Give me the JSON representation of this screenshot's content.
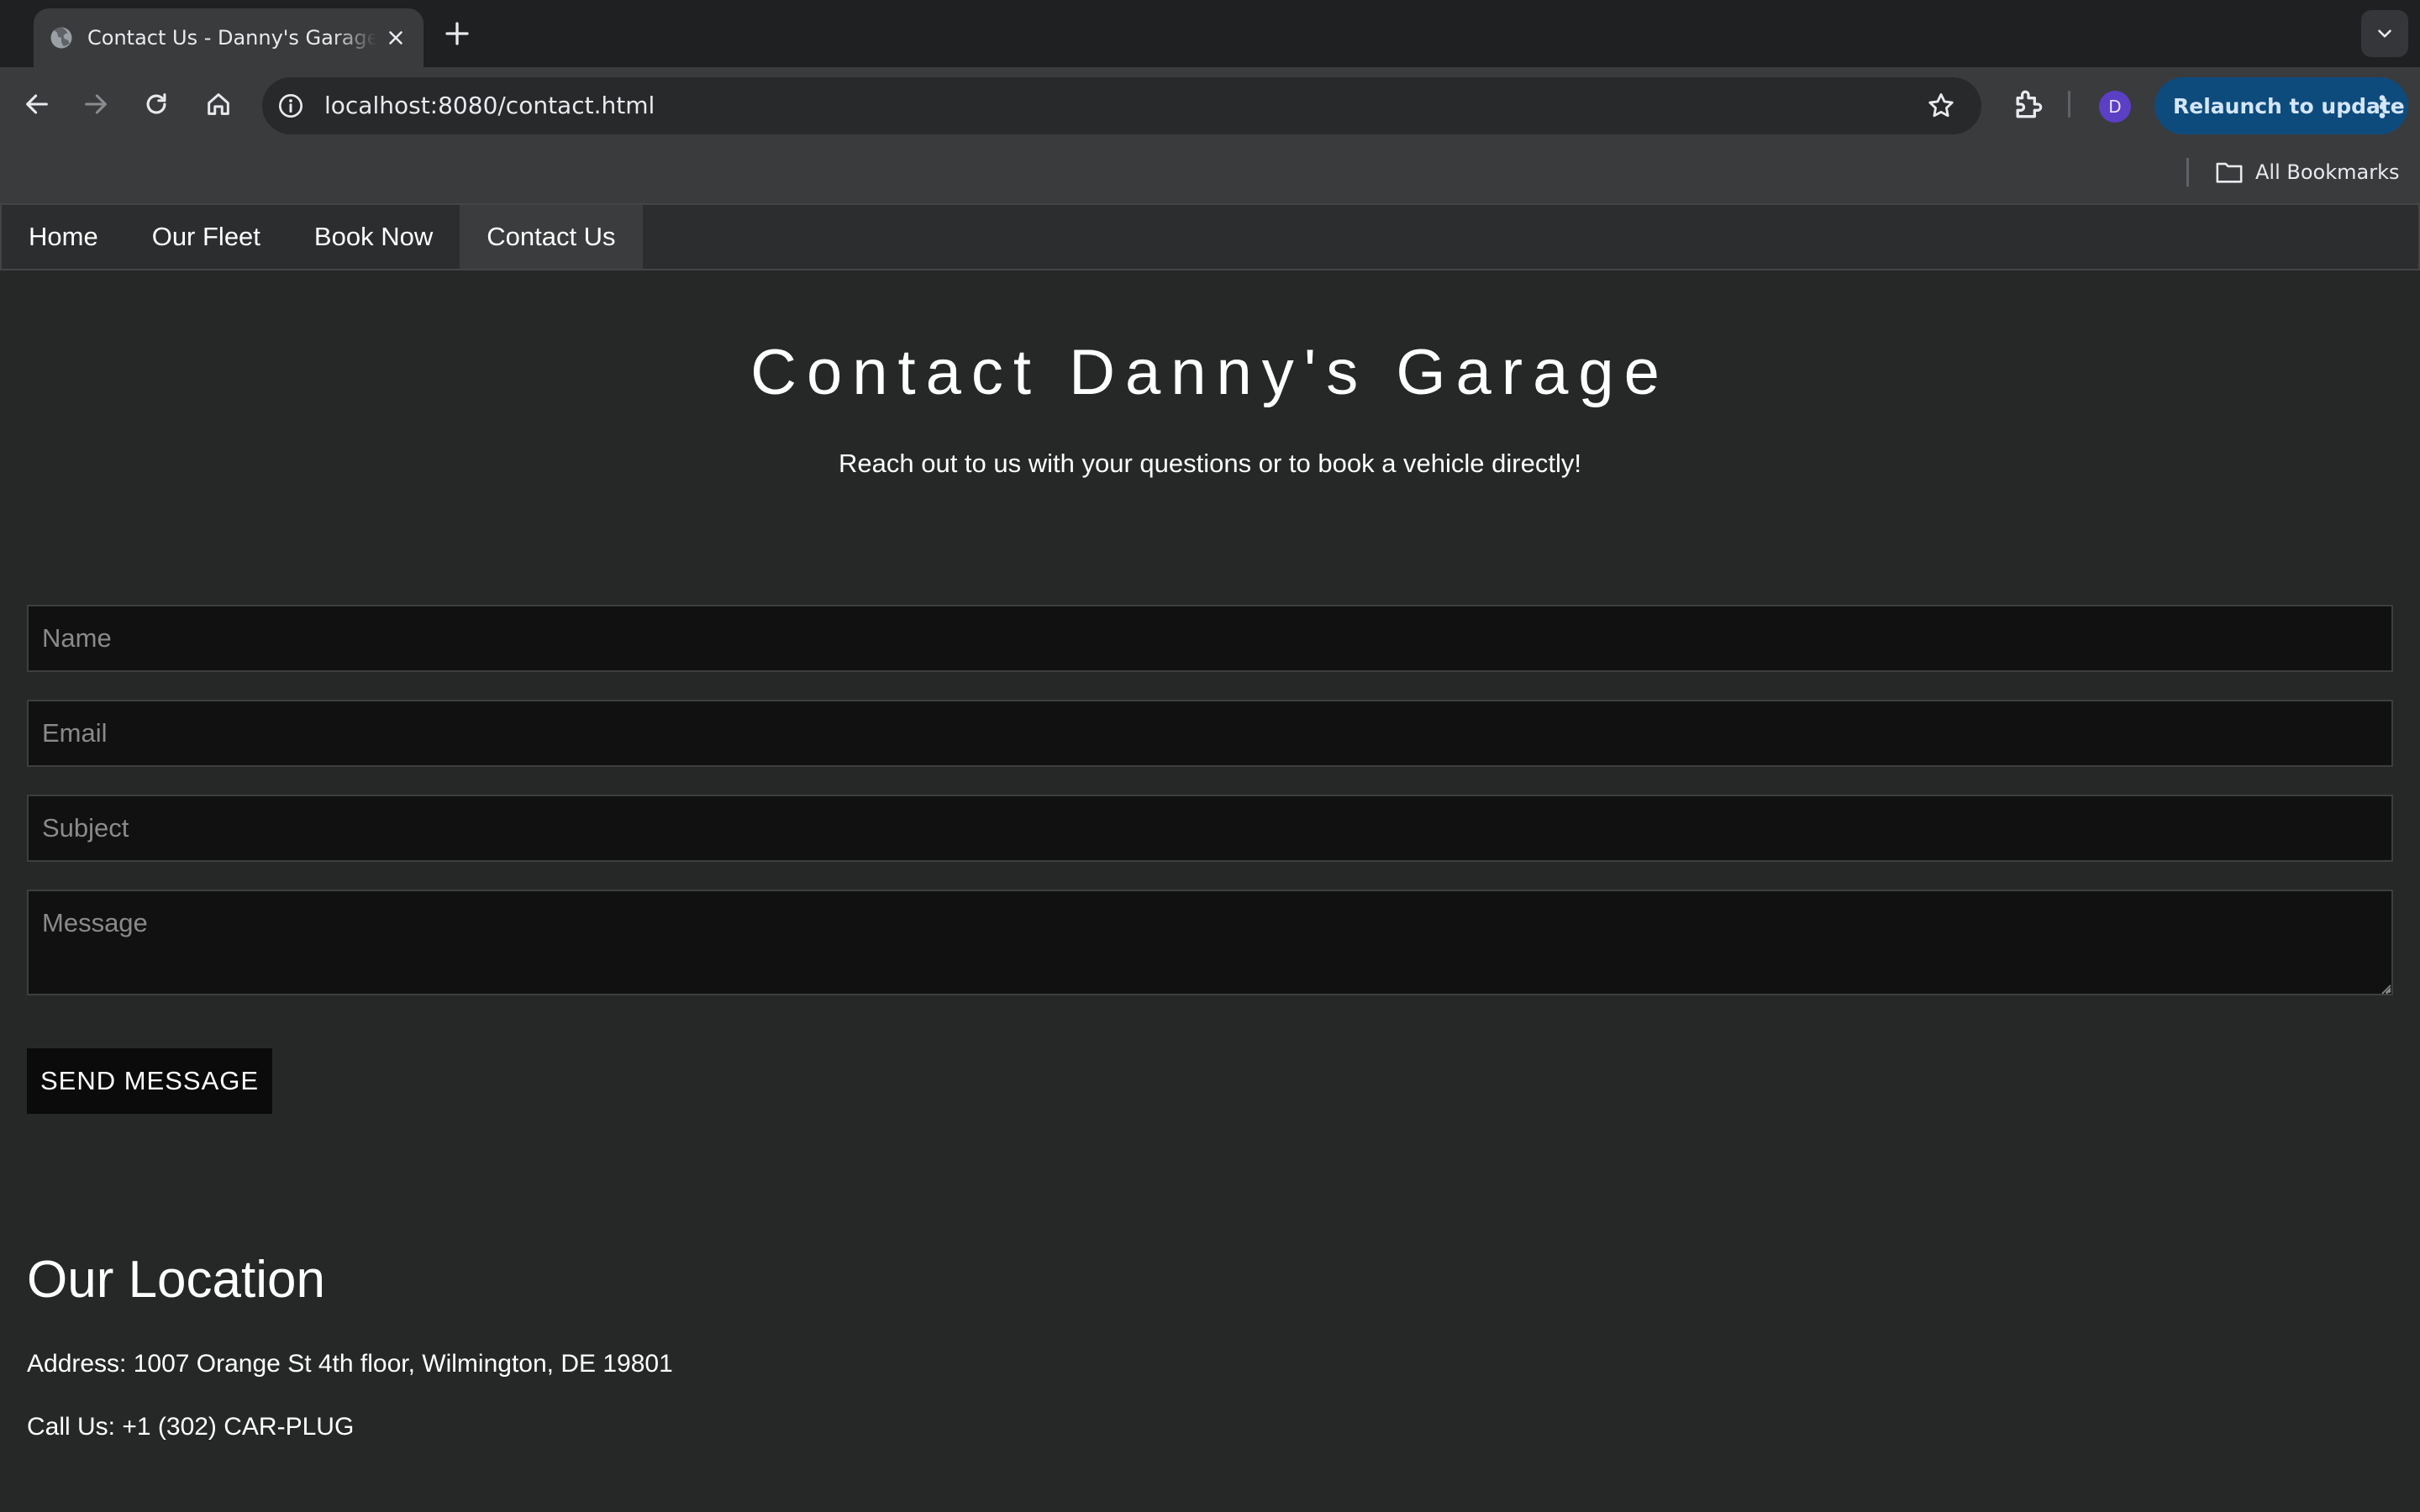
{
  "browser": {
    "tab_title": "Contact Us - Danny's Garage",
    "url": "localhost:8080/contact.html",
    "profile_initial": "D",
    "relaunch_label": "Relaunch to update",
    "all_bookmarks_label": "All Bookmarks",
    "colors": {
      "relaunch_bg": "#0e4b7d",
      "avatar_bg": "#5b3fc4"
    }
  },
  "nav": {
    "items": [
      {
        "label": "Home"
      },
      {
        "label": "Our Fleet"
      },
      {
        "label": "Book Now"
      },
      {
        "label": "Contact Us",
        "active": true
      }
    ]
  },
  "hero": {
    "title": "Contact Danny's Garage",
    "subtitle": "Reach out to us with your questions or to book a vehicle directly!"
  },
  "form": {
    "name_placeholder": "Name",
    "email_placeholder": "Email",
    "subject_placeholder": "Subject",
    "message_placeholder": "Message",
    "submit_label": "SEND MESSAGE"
  },
  "location": {
    "title": "Our Location",
    "address": "Address: 1007 Orange St 4th floor, Wilmington, DE 19801",
    "phone": "Call Us: +1 (302) CAR-PLUG"
  }
}
